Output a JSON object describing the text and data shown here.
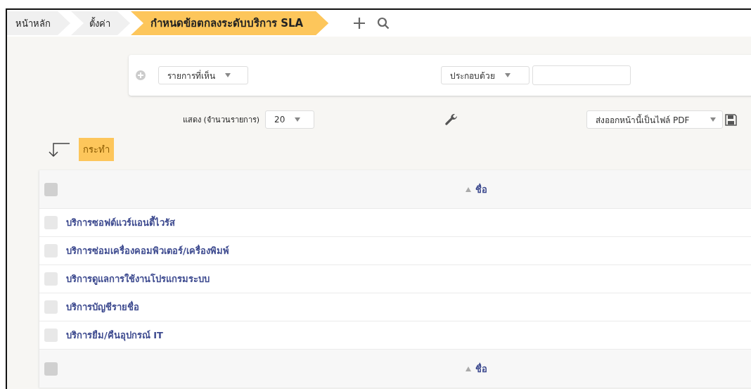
{
  "breadcrumb": [
    {
      "label": "หน้าหลัก",
      "selected": false
    },
    {
      "label": "ตั้งค่า",
      "selected": false
    },
    {
      "label": "กำหนดข้อตกลงระดับบริการ SLA",
      "selected": true
    }
  ],
  "filter": {
    "column_select": "รายการที่เห็น",
    "operator_select": "ประกอบด้วย"
  },
  "page_size": {
    "label": "แสดง (จำนวนรายการ)",
    "value": "20"
  },
  "export_select": "ส่งออกหน้านี้เป็นไฟล์ PDF",
  "action_button": "กระทำ",
  "table": {
    "header": {
      "column": "ชื่อ",
      "checked": false
    },
    "rows": [
      {
        "name": "บริการซอฟต์แวร์แอนตี้ไวรัส",
        "checked": false
      },
      {
        "name": "บริการซ่อมเครื่องคอมพิวเตอร์/เครื่องพิมพ์",
        "checked": false
      },
      {
        "name": "บริการดูแลการใช้งานโปรแกรมระบบ",
        "checked": false
      },
      {
        "name": "บริการบัญชีรายชื่อ",
        "checked": false
      },
      {
        "name": "บริการยืม/คืนอุปกรณ์ IT",
        "checked": false
      }
    ],
    "footer": {
      "column": "ชื่อ",
      "checked": false
    }
  }
}
